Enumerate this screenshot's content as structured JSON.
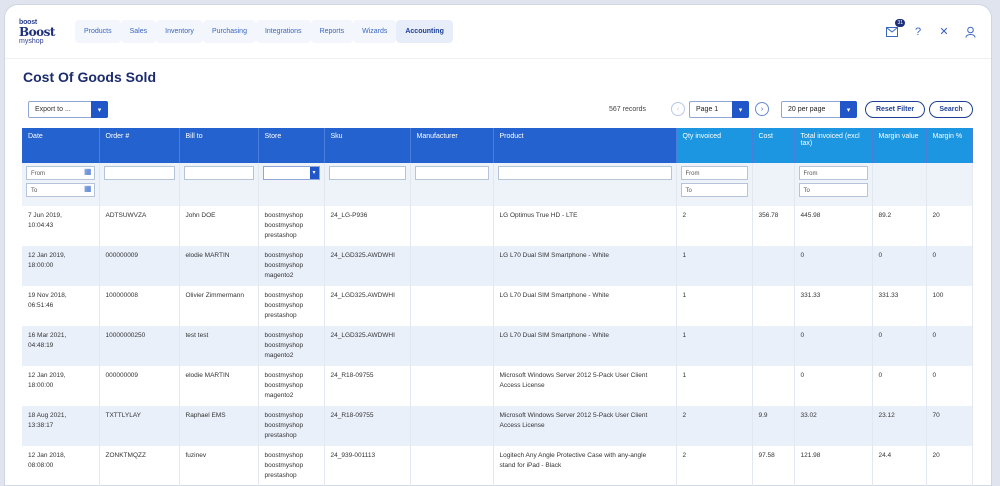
{
  "app": {
    "logo": {
      "line1": "boost",
      "line2": "Boost",
      "line3": "myshop"
    },
    "nav": [
      {
        "label": "Products",
        "active": false
      },
      {
        "label": "Sales",
        "active": false
      },
      {
        "label": "Inventory",
        "active": false
      },
      {
        "label": "Purchasing",
        "active": false
      },
      {
        "label": "Integrations",
        "active": false
      },
      {
        "label": "Reports",
        "active": false
      },
      {
        "label": "Wizards",
        "active": false
      },
      {
        "label": "Accounting",
        "active": true
      }
    ],
    "notification_count": "31",
    "icons": [
      "mail-icon",
      "help-icon",
      "tools-icon",
      "user-icon"
    ]
  },
  "page": {
    "title": "Cost Of Goods Sold"
  },
  "toolbar": {
    "export_label": "Export to ...",
    "records": "567 records",
    "page_label": "Page 1",
    "per_page": "20 per page",
    "reset_filter": "Reset Filter",
    "search": "Search"
  },
  "table": {
    "columns": [
      "Date",
      "Order #",
      "Bill to",
      "Store",
      "Sku",
      "Manufacturer",
      "Product",
      "Qty invoiced",
      "Cost",
      "Total invoiced (excl tax)",
      "Margin value",
      "Margin %"
    ],
    "filters": {
      "from": "From",
      "to": "To"
    },
    "rows": [
      {
        "date": [
          "7 Jun 2019,",
          "10:04:43"
        ],
        "order": "ADTSUWVZA",
        "bill": "John DOE",
        "store": [
          "boostmyshop",
          "boostmyshop",
          "prestashop"
        ],
        "sku": "24_LG-P936",
        "manufacturer": "",
        "product": [
          "LG Optimus True HD - LTE"
        ],
        "qty": "2",
        "cost": "356.78",
        "total": "445.98",
        "mvalue": "89.2",
        "mpct": "20"
      },
      {
        "date": [
          "12 Jan 2019,",
          "18:00:00"
        ],
        "order": "000000009",
        "bill": "elodie MARTIN",
        "store": [
          "boostmyshop",
          "boostmyshop",
          "magento2"
        ],
        "sku": "24_LGD325.AWDWHI",
        "manufacturer": "",
        "product": [
          "LG L70 Dual SIM Smartphone - White"
        ],
        "qty": "1",
        "cost": "",
        "total": "0",
        "mvalue": "0",
        "mpct": "0"
      },
      {
        "date": [
          "19 Nov 2018,",
          "06:51:46"
        ],
        "order": "100000008",
        "bill": "Olivier Zimmermann",
        "store": [
          "boostmyshop",
          "boostmyshop",
          "prestashop"
        ],
        "sku": "24_LGD325.AWDWHI",
        "manufacturer": "",
        "product": [
          "LG L70 Dual SIM Smartphone - White"
        ],
        "qty": "1",
        "cost": "",
        "total": "331.33",
        "mvalue": "331.33",
        "mpct": "100"
      },
      {
        "date": [
          "16 Mar 2021,",
          "04:48:19"
        ],
        "order": "10000000250",
        "bill": "test test",
        "store": [
          "boostmyshop",
          "boostmyshop",
          "magento2"
        ],
        "sku": "24_LGD325.AWDWHI",
        "manufacturer": "",
        "product": [
          "LG L70 Dual SIM Smartphone - White"
        ],
        "qty": "1",
        "cost": "",
        "total": "0",
        "mvalue": "0",
        "mpct": "0"
      },
      {
        "date": [
          "12 Jan 2019,",
          "18:00:00"
        ],
        "order": "000000009",
        "bill": "elodie MARTIN",
        "store": [
          "boostmyshop",
          "boostmyshop",
          "magento2"
        ],
        "sku": "24_R18-09755",
        "manufacturer": "",
        "product": [
          "Microsoft Windows Server 2012 5-Pack User Client",
          "Access License"
        ],
        "qty": "1",
        "cost": "",
        "total": "0",
        "mvalue": "0",
        "mpct": "0"
      },
      {
        "date": [
          "18 Aug 2021,",
          "13:38:17"
        ],
        "order": "TXTTLYLAY",
        "bill": "Raphael EMS",
        "store": [
          "boostmyshop",
          "boostmyshop",
          "prestashop"
        ],
        "sku": "24_R18-09755",
        "manufacturer": "",
        "product": [
          "Microsoft Windows Server 2012 5-Pack User Client",
          "Access License"
        ],
        "qty": "2",
        "cost": "9.9",
        "total": "33.02",
        "mvalue": "23.12",
        "mpct": "70"
      },
      {
        "date": [
          "12 Jan 2018,",
          "08:08:00"
        ],
        "order": "ZONKTMQZZ",
        "bill": "fuzinev",
        "store": [
          "boostmyshop",
          "boostmyshop",
          "prestashop"
        ],
        "sku": "24_939-001113",
        "manufacturer": "",
        "product": [
          "Logitech Any Angle Protective Case with any-angle",
          "stand for iPad - Black"
        ],
        "qty": "2",
        "cost": "97.58",
        "total": "121.98",
        "mvalue": "24.4",
        "mpct": "20"
      }
    ]
  }
}
